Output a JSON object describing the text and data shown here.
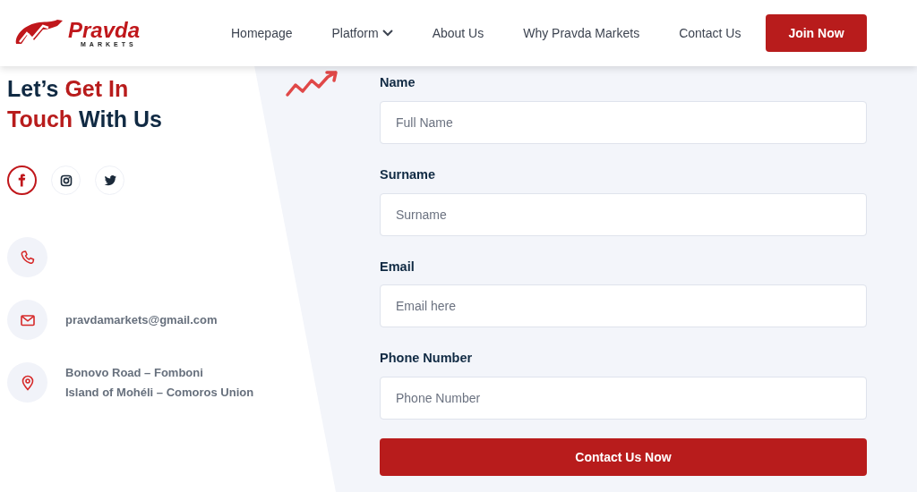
{
  "logo": {
    "name": "Pravda",
    "tagline": "MARKETS"
  },
  "nav": [
    {
      "label": "Homepage",
      "dropdown": false
    },
    {
      "label": "Platform",
      "dropdown": true
    },
    {
      "label": "About Us",
      "dropdown": false
    },
    {
      "label": "Why Pravda Markets",
      "dropdown": false
    },
    {
      "label": "Contact Us",
      "dropdown": false
    }
  ],
  "join_button": "Join Now",
  "heading": [
    {
      "parts": [
        {
          "text": "Let’s",
          "accent": false
        },
        {
          "text": "Get In",
          "accent": true
        }
      ]
    },
    {
      "parts": [
        {
          "text": "Touch",
          "accent": true
        },
        {
          "text": "With Us",
          "accent": false
        }
      ]
    }
  ],
  "socials": [
    {
      "kind": "facebook",
      "selected": true
    },
    {
      "kind": "instagram",
      "selected": false
    },
    {
      "kind": "twitter",
      "selected": false
    }
  ],
  "contacts": [
    {
      "kind": "phone"
    },
    {
      "kind": "email",
      "lines": [
        "pravdamarkets@gmail.com"
      ]
    },
    {
      "kind": "location",
      "lines": [
        "Bonovo Road – Fomboni",
        "Island of Mohéli – Comoros Union"
      ]
    }
  ],
  "form": {
    "fields": [
      {
        "label": "Name",
        "placeholder": "Full Name"
      },
      {
        "label": "Surname",
        "placeholder": "Surname"
      },
      {
        "label": "Email",
        "placeholder": "Email here"
      },
      {
        "label": "Phone Number",
        "placeholder": "Phone Number"
      }
    ],
    "submit": "Contact Us Now"
  }
}
